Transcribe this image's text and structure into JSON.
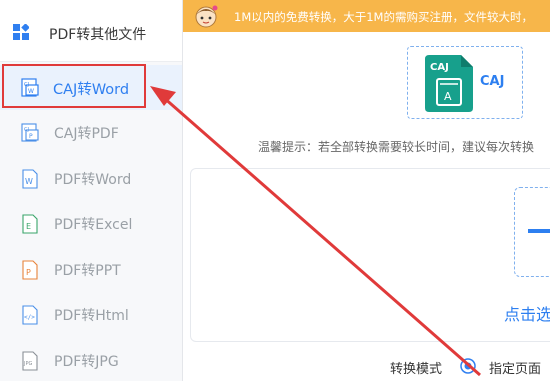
{
  "sidebar": {
    "header_title": "PDF转其他文件",
    "items": [
      {
        "label": "CAJ转Word",
        "icon": "caj-word-icon",
        "active": true
      },
      {
        "label": "CAJ转PDF",
        "icon": "caj-pdf-icon"
      },
      {
        "label": "PDF转Word",
        "icon": "pdf-word-icon"
      },
      {
        "label": "PDF转Excel",
        "icon": "pdf-excel-icon"
      },
      {
        "label": "PDF转PPT",
        "icon": "pdf-ppt-icon"
      },
      {
        "label": "PDF转Html",
        "icon": "pdf-html-icon"
      },
      {
        "label": "PDF转JPG",
        "icon": "pdf-jpg-icon"
      }
    ]
  },
  "banner": {
    "text": "1M以内的免费转换，大于1M的需购买注册，文件较大时，"
  },
  "main": {
    "file_icon_label": "CAJ",
    "file_icon_letter": "A",
    "format_side_label": "CAJ",
    "hint": "温馨提示：若全部转换需要较长时间，建议每次转换",
    "click_text": "点击选",
    "mode_label": "转换模式",
    "mode_option": "指定页面"
  },
  "colors": {
    "accent": "#2f7ff0",
    "banner": "#f7b64a",
    "caj_teal": "#17a08c",
    "annotation_red": "#e03a3a"
  }
}
